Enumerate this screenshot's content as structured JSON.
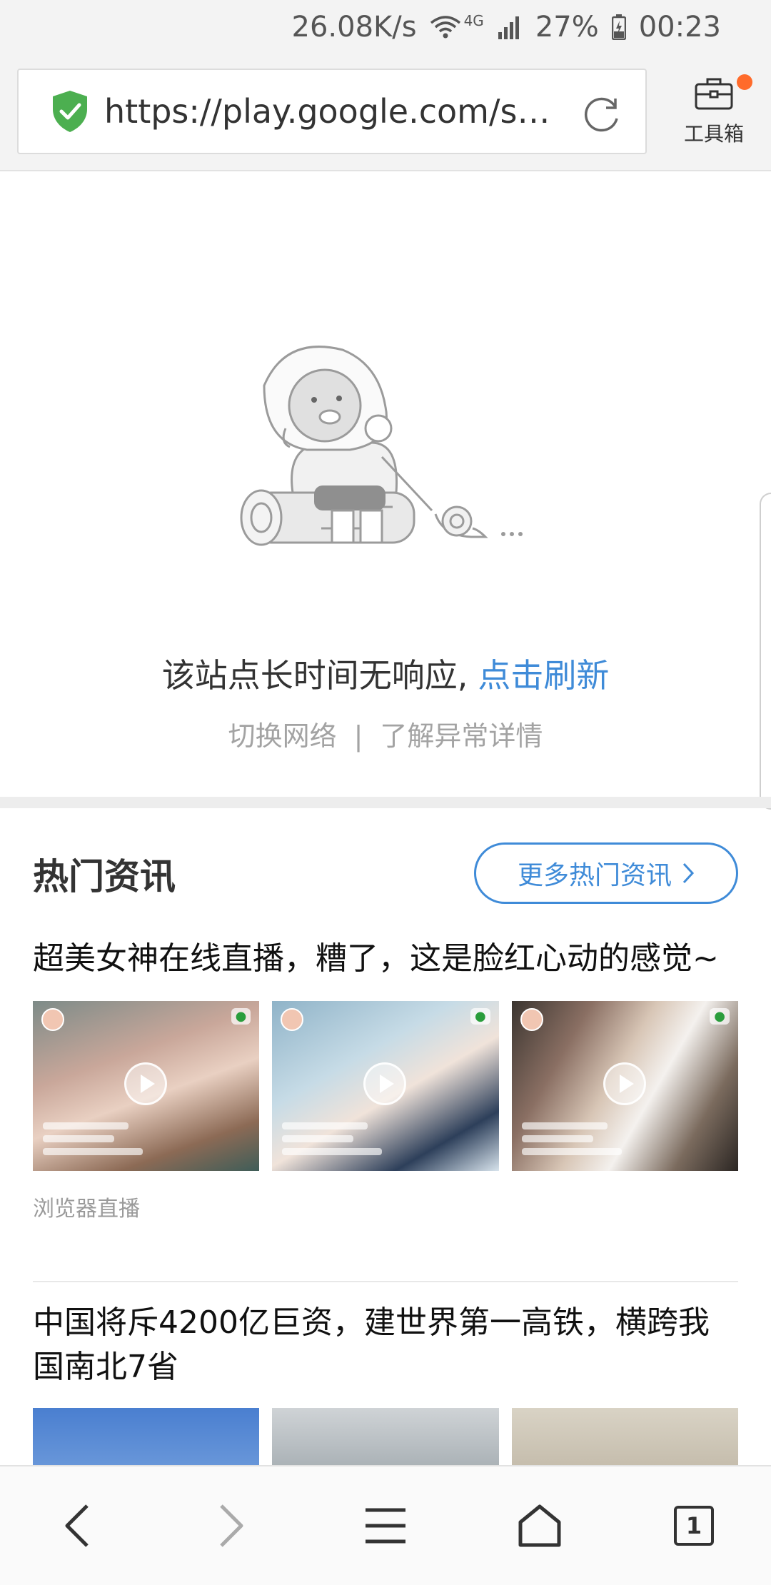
{
  "status_bar": {
    "speed": "26.08K/s",
    "network": "4G",
    "battery": "27%",
    "time": "00:23"
  },
  "toolbar": {
    "url": "https://play.google.com/sto...",
    "tools_label": "工具箱"
  },
  "error": {
    "message": "该站点长时间无响应,",
    "refresh_label": "点击刷新",
    "switch_network": "切换网络",
    "separator": "|",
    "details": "了解异常详情"
  },
  "news": {
    "section_title": "热门资讯",
    "more_label": "更多热门资讯",
    "articles": [
      {
        "title": "超美女神在线直播，糟了，这是脸红心动的感觉~",
        "source": "浏览器直播"
      },
      {
        "title": "中国将斥4200亿巨资，建世界第一高铁，横跨我国南北7省"
      }
    ]
  },
  "bottom_nav": {
    "tab_count": "1"
  },
  "colors": {
    "accent": "#3f8bd8",
    "badge": "#ff6b2b",
    "shield": "#4caf50"
  }
}
